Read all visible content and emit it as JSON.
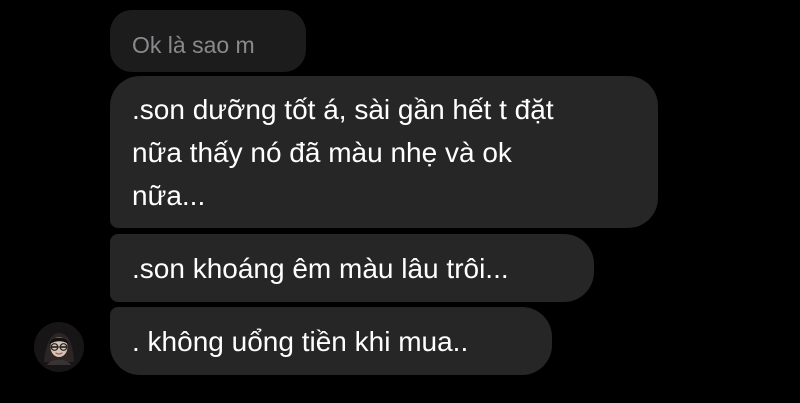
{
  "messages": {
    "reply_preview": "Ok là sao m",
    "items": [
      {
        "lines": [
          ".son dưỡng tốt á, sài gần hết t đặt",
          "nữa thấy nó đã màu nhẹ và ok",
          "nữa..."
        ]
      },
      {
        "lines": [
          ".son khoáng êm màu lâu trôi..."
        ]
      },
      {
        "lines": [
          ". không uổng tiền khi mua.."
        ]
      }
    ]
  },
  "colors": {
    "background": "#000000",
    "bubble": "#262627",
    "reply_preview_bubble": "#1c1c1d",
    "reply_preview_text": "#8a8a8e",
    "message_text": "#ffffff"
  },
  "icons": {
    "avatar": "avatar-icon"
  }
}
